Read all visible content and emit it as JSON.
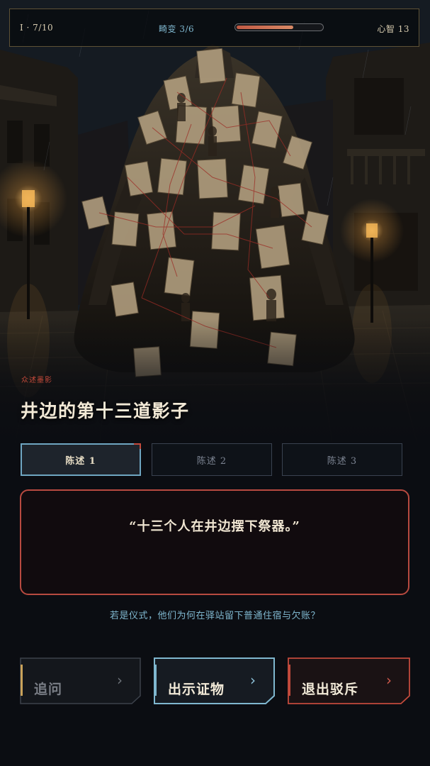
{
  "status": {
    "chapter": "I · 7/10",
    "anomaly_label": "畸变 3/6",
    "anomaly_progress": 0.5,
    "sanity_label": "心智 13"
  },
  "scene": {
    "subtitle": "众述墨影",
    "title": "井边的第十三道影子"
  },
  "tabs": [
    {
      "label": "陈述 1",
      "active": true
    },
    {
      "label": "陈述 2",
      "active": false
    },
    {
      "label": "陈述 3",
      "active": false
    }
  ],
  "statement": {
    "quote": "“十三个人在井边摆下祭器。”"
  },
  "hint": "若是仪式，他们为何在驿站留下普通住宿与欠账？",
  "actions": {
    "press": {
      "label": "追问",
      "icon": "chevron-right-icon"
    },
    "evidence": {
      "label": "出示证物",
      "icon": "chevron-right-icon"
    },
    "exit": {
      "label": "退出驳斥",
      "icon": "chevron-right-icon"
    }
  },
  "colors": {
    "accent_blue": "#7fb7cf",
    "accent_red": "#c24a3c",
    "accent_gold": "#c9a25a",
    "background": "#0b0d12"
  }
}
